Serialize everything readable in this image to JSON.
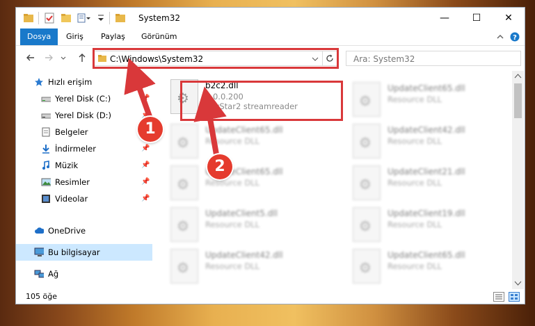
{
  "window": {
    "title": "System32",
    "minimize_glyph": "—",
    "maximize_glyph": "☐",
    "close_glyph": "✕"
  },
  "ribbon": {
    "tabs": [
      "Dosya",
      "Giriş",
      "Paylaş",
      "Görünüm"
    ],
    "active_tab": "Dosya",
    "accent_color": "#1979ca"
  },
  "nav": {
    "address": "C:\\Windows\\System32",
    "search_placeholder": "Ara: System32"
  },
  "sidebar": {
    "items": [
      {
        "label": "Hızlı erişim",
        "icon": "star-icon",
        "pinned": false
      },
      {
        "label": "Yerel Disk (C:)",
        "icon": "drive-icon",
        "pinned": true
      },
      {
        "label": "Yerel Disk (D:)",
        "icon": "drive-icon",
        "pinned": true
      },
      {
        "label": "Belgeler",
        "icon": "documents-icon",
        "pinned": true
      },
      {
        "label": "İndirmeler",
        "icon": "download-icon",
        "pinned": true
      },
      {
        "label": "Müzik",
        "icon": "music-icon",
        "pinned": true
      },
      {
        "label": "Resimler",
        "icon": "pictures-icon",
        "pinned": true
      },
      {
        "label": "Videolar",
        "icon": "video-icon",
        "pinned": true
      },
      {
        "label": "OneDrive",
        "icon": "cloud-icon",
        "pinned": false
      },
      {
        "label": "Bu bilgisayar",
        "icon": "computer-icon",
        "pinned": false,
        "selected": true
      },
      {
        "label": "Ağ",
        "icon": "network-icon",
        "pinned": false
      }
    ]
  },
  "files": {
    "highlighted": {
      "name": "b2c2.dll",
      "version": "1.0.0.200",
      "description": "SkyStar2 streamreader"
    },
    "left_column": [
      {
        "name": "UpdateClient65.dll",
        "type": "Resource DLL"
      },
      {
        "name": "UpdateClient65.dll",
        "type": "Resource DLL"
      },
      {
        "name": "UpdateClient5.dll",
        "type": "Resource DLL"
      },
      {
        "name": "UpdateClient42.dll",
        "type": "Resource DLL"
      }
    ],
    "right_column": [
      {
        "name": "UpdateClient65.dll",
        "type": "Resource DLL"
      },
      {
        "name": "UpdateClient42.dll",
        "type": "Resource DLL"
      },
      {
        "name": "UpdateClient21.dll",
        "type": "Resource DLL"
      },
      {
        "name": "UpdateClient19.dll",
        "type": "Resource DLL"
      },
      {
        "name": "UpdateClient65.dll",
        "type": "Resource DLL"
      }
    ]
  },
  "status": {
    "item_count": "105 öğe"
  },
  "annotations": {
    "step1": "1",
    "step2": "2",
    "color": "#d9383a"
  }
}
